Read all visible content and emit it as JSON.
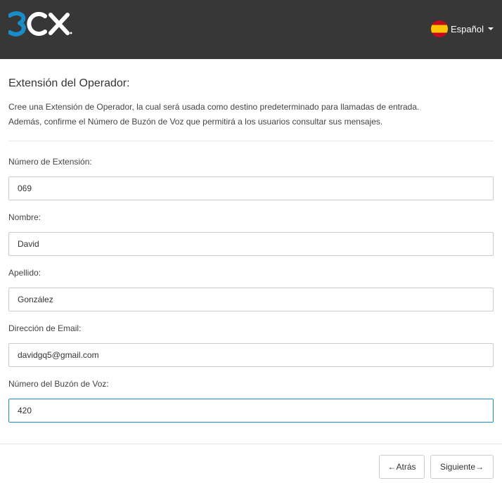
{
  "header": {
    "logo_text": "3CX",
    "language": {
      "label": "Español",
      "flag_icon": "spain-flag-icon"
    }
  },
  "page": {
    "title": "Extensión del Operador:",
    "description_line1": "Cree una Extensión de Operador, la cual será usada como destino predeterminado para llamadas de entrada.",
    "description_line2": "Además, confirme el Número de Buzón de Voz que permitirá a los usuarios consultar sus mensajes."
  },
  "form": {
    "fields": [
      {
        "label": "Número de Extensión:",
        "value": "069"
      },
      {
        "label": "Nombre:",
        "value": "David"
      },
      {
        "label": "Apellido:",
        "value": "González"
      },
      {
        "label": "Dirección de Email:",
        "value": "davidgq5@gmail.com"
      },
      {
        "label": "Número del Buzón de Voz:",
        "value": "420"
      }
    ]
  },
  "footer": {
    "back_label": "←Atrás",
    "next_label": "Siguiente→"
  },
  "colors": {
    "header_bg": "#373737",
    "logo_blue": "#1a8cc8",
    "focus_border": "#1a8cc8"
  }
}
